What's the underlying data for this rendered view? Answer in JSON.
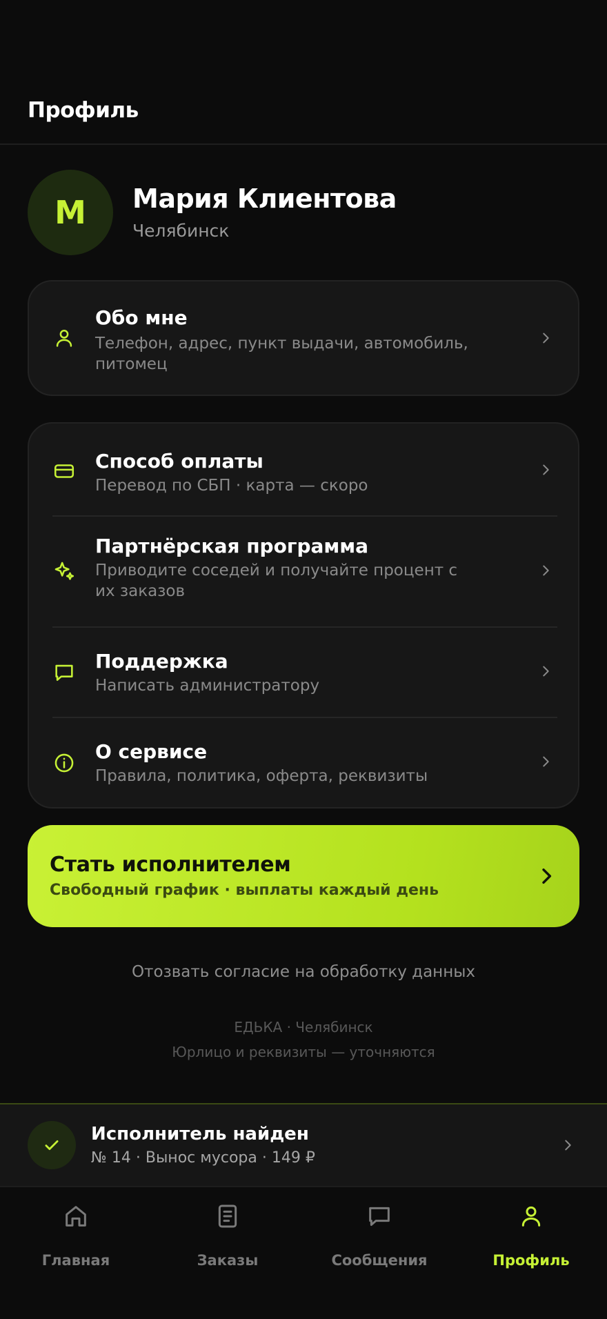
{
  "header": {
    "title": "Профиль"
  },
  "profile": {
    "avatar_letter": "М",
    "name": "Мария Клиентова",
    "city": "Челябинск"
  },
  "about": {
    "title": "Обо мне",
    "subtitle": "Телефон, адрес, пункт выдачи, автомобиль, питомец",
    "icon": "user-icon"
  },
  "menu": [
    {
      "title": "Способ оплаты",
      "subtitle": "Перевод по СБП · карта — скоро",
      "icon": "card-icon"
    },
    {
      "title": "Партнёрская программа",
      "subtitle": "Приводите соседей и получайте процент с их заказов",
      "icon": "sparkle-icon"
    },
    {
      "title": "Поддержка",
      "subtitle": "Написать администратору",
      "icon": "chat-icon"
    },
    {
      "title": "О сервисе",
      "subtitle": "Правила, политика, оферта, реквизиты",
      "icon": "info-icon"
    }
  ],
  "cta": {
    "title": "Стать исполнителем",
    "subtitle": "Свободный график · выплаты каждый день"
  },
  "revoke_link": "Отозвать согласие на обработку данных",
  "footer": {
    "line1": "ЕДЬКА · Челябинск",
    "line2": "Юрлицо и реквизиты — уточняются"
  },
  "notification": {
    "title": "Исполнитель найден",
    "subtitle": "№ 14 · Вынос мусора · 149 ₽",
    "icon": "check-icon"
  },
  "tabs": [
    {
      "label": "Главная",
      "icon": "home-icon",
      "active": false
    },
    {
      "label": "Заказы",
      "icon": "orders-icon",
      "active": false
    },
    {
      "label": "Сообщения",
      "icon": "messages-icon",
      "active": false
    },
    {
      "label": "Профиль",
      "icon": "profile-icon",
      "active": true
    }
  ],
  "colors": {
    "accent": "#c6f135",
    "background": "#0c0c0c",
    "card": "#171717",
    "muted_text": "#8a8a8a"
  }
}
